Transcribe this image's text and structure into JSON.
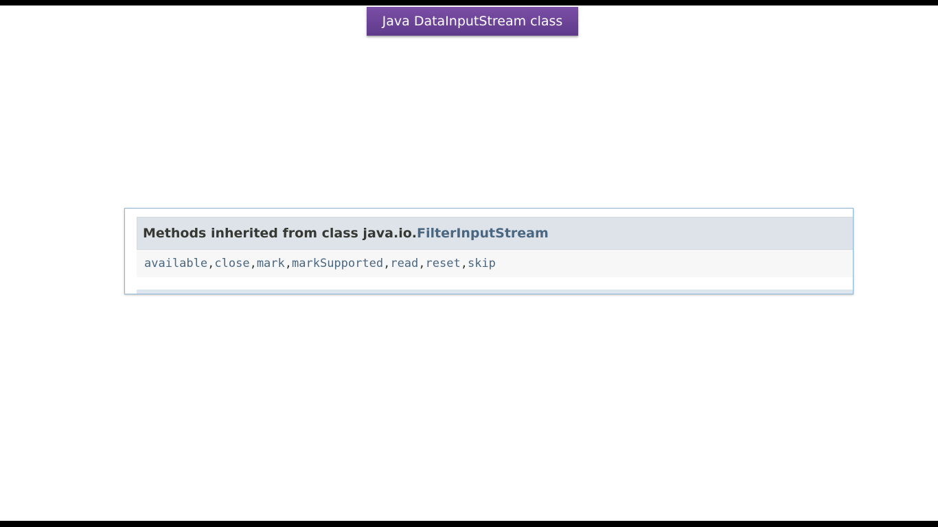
{
  "slide": {
    "title": "Java DataInputStream class"
  },
  "doc": {
    "header_prefix": "Methods inherited from class java.io.",
    "header_class": "FilterInputStream",
    "methods": [
      "available",
      "close",
      "mark",
      "markSupported",
      "read",
      "reset",
      "skip"
    ],
    "separator": ", "
  }
}
